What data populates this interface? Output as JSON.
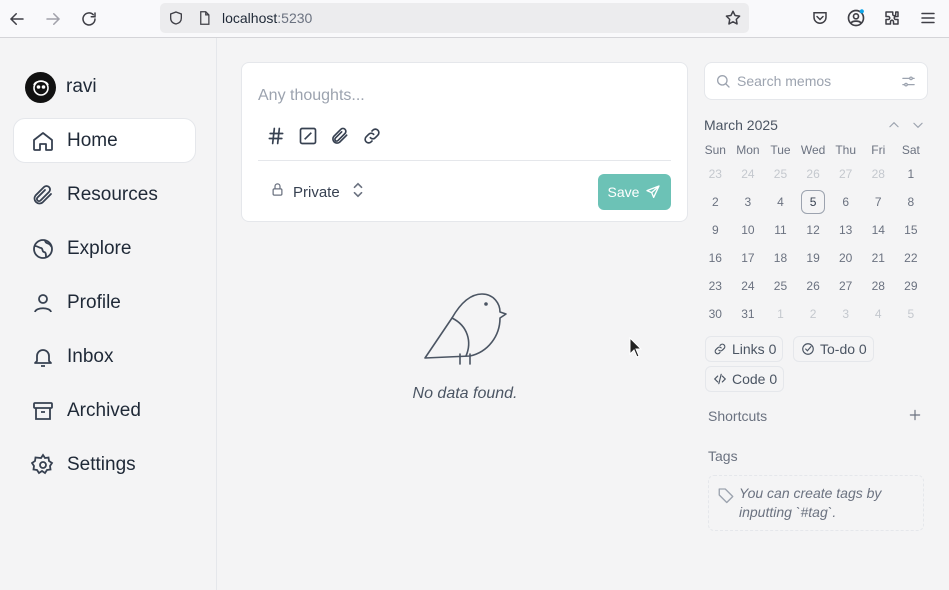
{
  "browser": {
    "host": "localhost",
    "port": ":5230"
  },
  "sidebar": {
    "brand": "ravi",
    "items": [
      {
        "label": "Home"
      },
      {
        "label": "Resources"
      },
      {
        "label": "Explore"
      },
      {
        "label": "Profile"
      },
      {
        "label": "Inbox"
      },
      {
        "label": "Archived"
      },
      {
        "label": "Settings"
      }
    ]
  },
  "editor": {
    "placeholder": "Any thoughts...",
    "visibility": "Private",
    "save_label": "Save"
  },
  "empty": {
    "message": "No data found."
  },
  "search": {
    "placeholder": "Search memos"
  },
  "calendar": {
    "month": "March 2025",
    "weekdays": [
      "Sun",
      "Mon",
      "Tue",
      "Wed",
      "Thu",
      "Fri",
      "Sat"
    ],
    "days": [
      {
        "d": "23",
        "m": true
      },
      {
        "d": "24",
        "m": true
      },
      {
        "d": "25",
        "m": true
      },
      {
        "d": "26",
        "m": true
      },
      {
        "d": "27",
        "m": true
      },
      {
        "d": "28",
        "m": true
      },
      {
        "d": "1"
      },
      {
        "d": "2"
      },
      {
        "d": "3"
      },
      {
        "d": "4"
      },
      {
        "d": "5",
        "today": true
      },
      {
        "d": "6"
      },
      {
        "d": "7"
      },
      {
        "d": "8"
      },
      {
        "d": "9"
      },
      {
        "d": "10"
      },
      {
        "d": "11"
      },
      {
        "d": "12"
      },
      {
        "d": "13"
      },
      {
        "d": "14"
      },
      {
        "d": "15"
      },
      {
        "d": "16"
      },
      {
        "d": "17"
      },
      {
        "d": "18"
      },
      {
        "d": "19"
      },
      {
        "d": "20"
      },
      {
        "d": "21"
      },
      {
        "d": "22"
      },
      {
        "d": "23"
      },
      {
        "d": "24"
      },
      {
        "d": "25"
      },
      {
        "d": "26"
      },
      {
        "d": "27"
      },
      {
        "d": "28"
      },
      {
        "d": "29"
      },
      {
        "d": "30"
      },
      {
        "d": "31"
      },
      {
        "d": "1",
        "m": true
      },
      {
        "d": "2",
        "m": true
      },
      {
        "d": "3",
        "m": true
      },
      {
        "d": "4",
        "m": true
      },
      {
        "d": "5",
        "m": true
      }
    ]
  },
  "stats": {
    "links": "Links 0",
    "todo": "To-do 0",
    "code": "Code 0"
  },
  "shortcuts": {
    "label": "Shortcuts"
  },
  "tags": {
    "label": "Tags",
    "hint": "You can create tags by inputting `#tag`."
  },
  "colors": {
    "accent": "#6cc2b6"
  }
}
